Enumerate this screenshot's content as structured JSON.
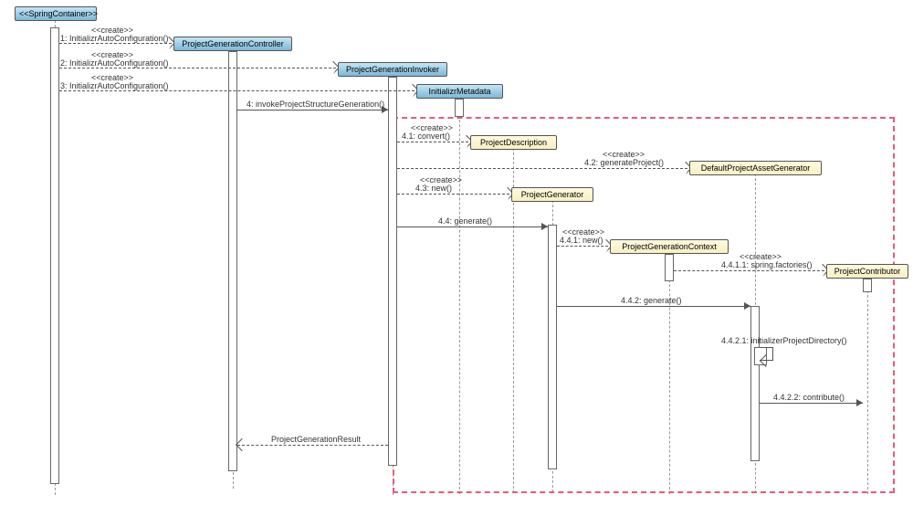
{
  "participants": {
    "springContainer": "<<SpringContainer>>",
    "pgController": "ProjectGenerationController",
    "pgInvoker": "ProjectGenerationInvoker",
    "initializrMetadata": "InitializrMetadata",
    "projectDescription": "ProjectDescription",
    "defaultAssetGen": "DefaultProjectAssetGenerator",
    "projectGenerator": "ProjectGenerator",
    "pgContext": "ProjectGenerationContext",
    "projectContributor": "ProjectContributor"
  },
  "messages": {
    "create1_stereo": "<<create>>",
    "create1": "1: InitializrAutoConfiguration()",
    "create2_stereo": "<<create>>",
    "create2": "2: InitializrAutoConfiguration()",
    "create3_stereo": "<<create>>",
    "create3": "3: InitializrAutoConfiguration()",
    "m4": "4: invokeProjectStructureGeneration()",
    "m41_stereo": "<<create>>",
    "m41": "4.1: convert()",
    "m42_stereo": "<<create>>",
    "m42": "4.2: generateProject()",
    "m43_stereo": "<<create>>",
    "m43": "4.3: new()",
    "m44": "4.4: generate()",
    "m441_stereo": "<<create>>",
    "m441": "4.4.1: new()",
    "m4411_stereo": "<<create>>",
    "m4411": "4.4.1.1: spring.factories()",
    "m442": "4.4.2: generate()",
    "m4421": "4.4.2.1: initializerProjectDirectory()",
    "m4422": "4.4.2.2: contribute()",
    "return": "ProjectGenerationResult"
  }
}
